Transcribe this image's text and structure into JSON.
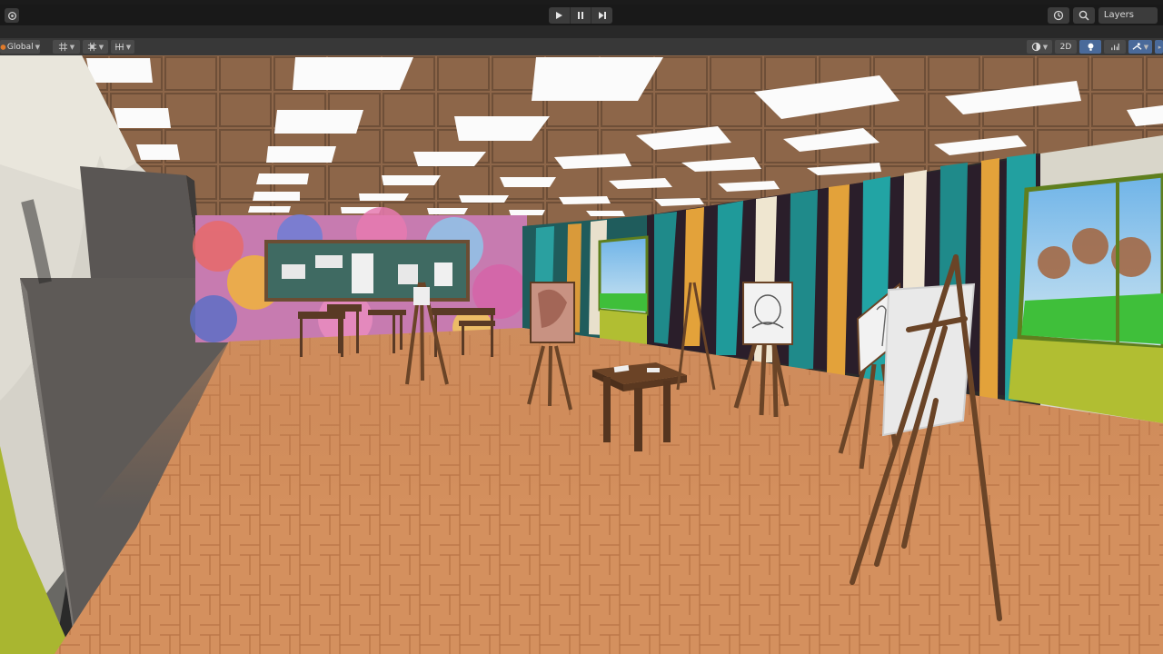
{
  "toolbar": {
    "play_icon": "play-icon",
    "pause_icon": "pause-icon",
    "step_icon": "step-icon",
    "history_icon": "history-icon",
    "search_icon": "search-icon",
    "layers_label": "Layers"
  },
  "scene_toolbar": {
    "handle_mode_label": "Global",
    "view_2d_label": "2D",
    "icons": [
      "grid-icon",
      "snap-icon",
      "increment-snap-icon",
      "shading-mode-icon",
      "light-icon",
      "audio-icon",
      "effects-icon",
      "gizmo-icon"
    ]
  },
  "viewport": {
    "scene": "art classroom",
    "colors": {
      "floor": "#d08a5a",
      "ceiling": "#8a6448",
      "wall_green": "#a8b830",
      "board": "#3f6a62"
    }
  }
}
